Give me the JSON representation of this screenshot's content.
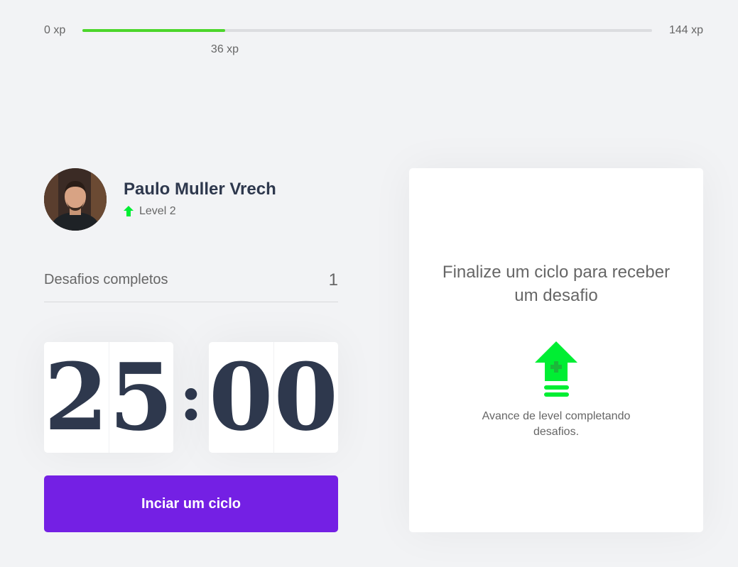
{
  "xp": {
    "min_label": "0 xp",
    "max_label": "144 xp",
    "current_label": "36 xp",
    "current": 36,
    "max": 144,
    "fill_color": "#4cd62b"
  },
  "profile": {
    "name": "Paulo Muller Vrech",
    "level_label": "Level 2",
    "level_icon": "level-up-arrow-icon",
    "avatar": "user-photo"
  },
  "completed": {
    "label": "Desafios completos",
    "count": "1"
  },
  "countdown": {
    "minute_left": "2",
    "minute_right": "5",
    "separator": ":",
    "second_left": "0",
    "second_right": "0"
  },
  "start_button": {
    "label": "Inciar um ciclo",
    "color": "#7420e4"
  },
  "challenge_box": {
    "title": "Finalize um ciclo para receber um desafio",
    "icon": "level-up-icon",
    "hint": "Avance de level completando desafios.",
    "icon_color": "#00ee33"
  }
}
